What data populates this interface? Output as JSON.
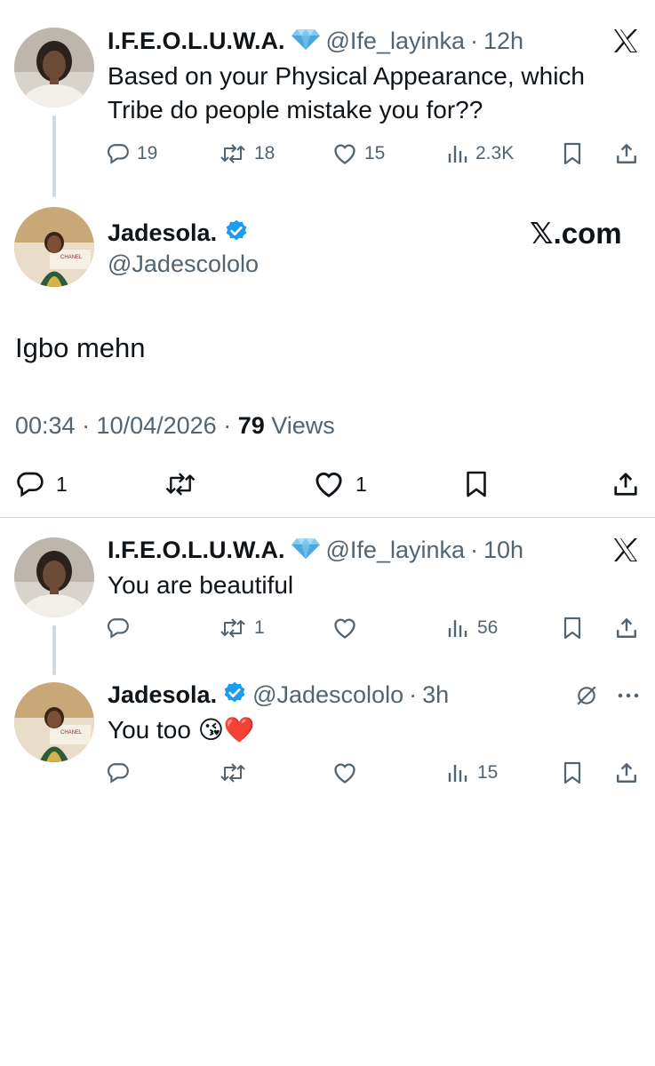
{
  "post1": {
    "display_name": "I.F.E.O.L.U.W.A.",
    "handle": "@Ife_layinka",
    "time": "12h",
    "text_line1": "Based on your Physical Appearance, which",
    "text_line2": "Tribe do people mistake you for??",
    "replies": "19",
    "reposts": "18",
    "likes": "15",
    "views": "2.3K"
  },
  "main": {
    "display_name": "Jadesola.",
    "handle": "@Jadescololo",
    "brand": "𝕏.com",
    "text": "Igbo mehn",
    "datetime": "00:34 · 10/04/2026 · ",
    "views_count": "79",
    "views_label": " Views",
    "replies": "1",
    "likes": "1"
  },
  "reply1": {
    "display_name": "I.F.E.O.L.U.W.A.",
    "handle": "@Ife_layinka",
    "time": "10h",
    "text": "You are beautiful",
    "reposts": "1",
    "views": "56"
  },
  "reply2": {
    "display_name": "Jadesola.",
    "handle": "@Jadescololo",
    "time": "3h",
    "text": "You too",
    "emoji": "😘❤️",
    "views": "15"
  },
  "icons": {
    "x_logo": "x-logo-icon",
    "diamond": "diamond-icon",
    "verified": "verified-badge-icon",
    "reply": "reply-icon",
    "repost": "repost-icon",
    "like": "heart-icon",
    "views": "views-icon",
    "bookmark": "bookmark-icon",
    "share": "share-icon",
    "grok": "grok-icon",
    "more": "more-icon"
  },
  "colors": {
    "text": "#0f1419",
    "secondary": "#536471",
    "verified": "#1d9bf0",
    "diamond": "#5bb6e8",
    "divider": "#cfd9de"
  }
}
